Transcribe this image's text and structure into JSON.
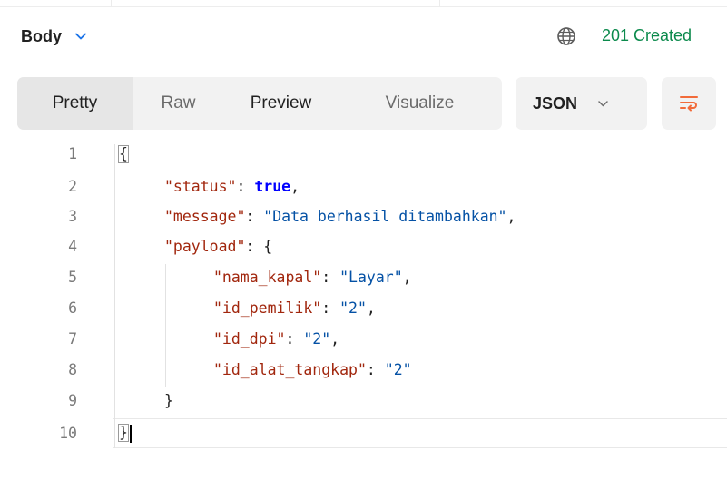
{
  "body_section": {
    "title": "Body",
    "status_text": "201 Created",
    "tabs": [
      "Pretty",
      "Raw",
      "Preview",
      "Visualize"
    ],
    "active_tab": "Pretty",
    "format": "JSON"
  },
  "response": {
    "lines": [
      {
        "no": "1"
      },
      {
        "no": "2",
        "key": "\"status\"",
        "value": "true"
      },
      {
        "no": "3",
        "key": "\"message\"",
        "value": "\"Data berhasil ditambahkan\""
      },
      {
        "no": "4",
        "key": "\"payload\"",
        "open": "{"
      },
      {
        "no": "5",
        "key": "\"nama_kapal\"",
        "value": "\"Layar\""
      },
      {
        "no": "6",
        "key": "\"id_pemilik\"",
        "value": "\"2\""
      },
      {
        "no": "7",
        "key": "\"id_dpi\"",
        "value": "\"2\""
      },
      {
        "no": "8",
        "key": "\"id_alat_tangkap\"",
        "value": "\"2\""
      },
      {
        "no": "9",
        "close": "}"
      },
      {
        "no": "10"
      }
    ],
    "open_brace": "{",
    "close_brace": "}",
    "colon": ": ",
    "comma": ","
  },
  "colors": {
    "status_green": "#0b8a4c",
    "accent_orange": "#f26b3a",
    "key_color": "#a1260d",
    "string_color": "#0451a5"
  },
  "icons": [
    "chevron-down-icon",
    "globe-icon",
    "chevron-down-icon",
    "wrap-lines-icon"
  ]
}
